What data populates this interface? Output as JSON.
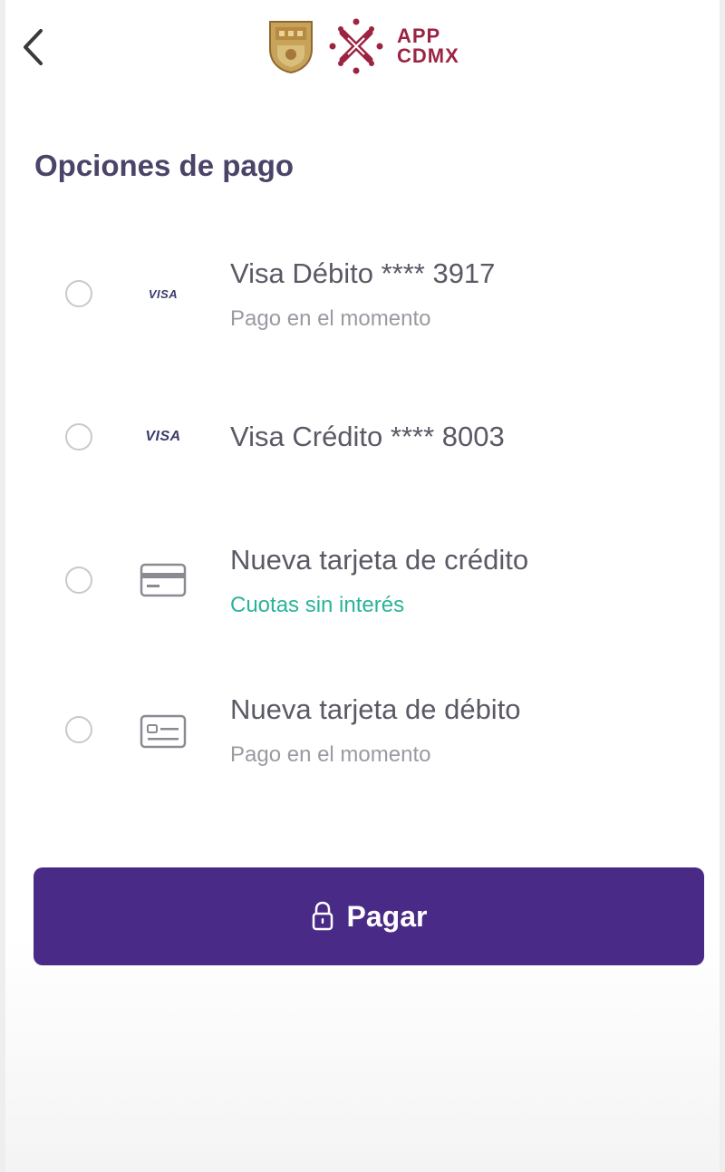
{
  "header": {
    "back_icon": "chevron-left-icon",
    "app_name_line1": "APP",
    "app_name_line2": "CDMX"
  },
  "page": {
    "title": "Opciones de pago"
  },
  "options": [
    {
      "brand": "VISA",
      "title": "Visa Débito **** 3917",
      "subtitle": "Pago en el momento"
    },
    {
      "brand": "VISA",
      "title": "Visa Crédito **** 8003",
      "subtitle": ""
    },
    {
      "icon": "credit-card-icon",
      "title": "Nueva tarjeta de crédito",
      "subtitle": "Cuotas sin interés"
    },
    {
      "icon": "debit-card-icon",
      "title": "Nueva tarjeta de débito",
      "subtitle": "Pago en el momento"
    }
  ],
  "pay_button": {
    "icon": "lock-icon",
    "label": "Pagar"
  },
  "colors": {
    "primary": "#4a2a87",
    "title": "#4b4468",
    "accent_green": "#2bb39a",
    "brand_red": "#9c2443"
  }
}
